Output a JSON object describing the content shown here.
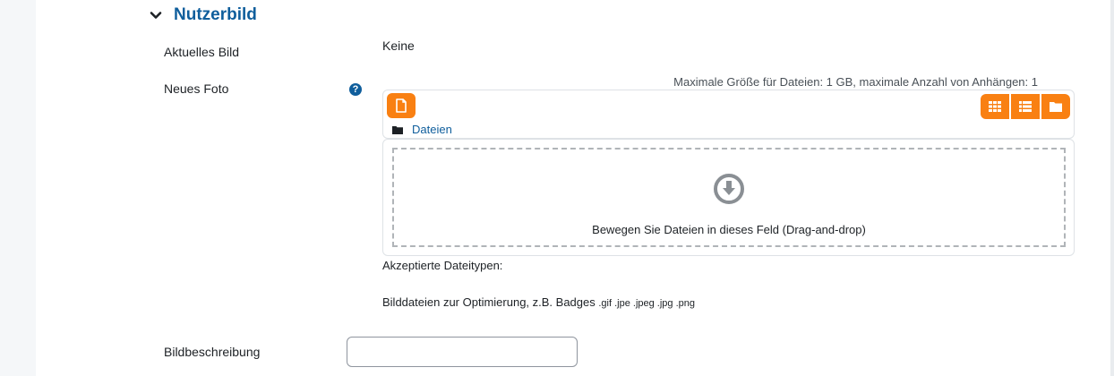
{
  "section": {
    "title": "Nutzerbild"
  },
  "current_picture": {
    "label": "Aktuelles Bild",
    "value": "Keine"
  },
  "new_picture": {
    "label": "Neues Foto",
    "help_icon": "question-circle-icon",
    "max_size_text": "Maximale Größe für Dateien: 1 GB, maximale Anzahl von Anhängen: 1",
    "add_icon": "file-icon",
    "view_icons": [
      "grid-icon",
      "list-icon",
      "folder-icon"
    ],
    "path_label": "Dateien",
    "drop_icon": "arrow-down-circle-icon",
    "drop_text": "Bewegen Sie Dateien in dieses Feld (Drag-and-drop)",
    "accepted_label": "Akzeptierte Dateitypen:",
    "accepted_desc": "Bilddateien zur Optimierung, z.B. Badges",
    "accepted_ext": ".gif .jpe .jpeg .jpg .png"
  },
  "image_description": {
    "label": "Bildbeschreibung",
    "value": ""
  },
  "colors": {
    "accent": "#0f5e9c",
    "button": "#f98012"
  }
}
